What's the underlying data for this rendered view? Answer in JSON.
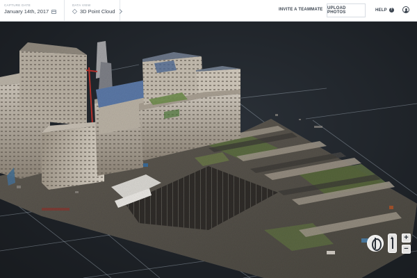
{
  "header": {
    "capture_date": {
      "label": "CAPTURE DATE",
      "value": "January 14th, 2017",
      "icon": "calendar-icon"
    },
    "data_view": {
      "label": "DATA VIEW",
      "value": "3D Point Cloud",
      "icon": "cube-icon"
    },
    "invite_label": "INVITE A TEAMMATE",
    "upload_label": "UPLOAD PHOTOS",
    "help_label": "HELP",
    "help_icon": "?"
  },
  "controls": {
    "zoom_in": "+",
    "zoom_out": "−"
  },
  "colors": {
    "viewport_bg": "#1d2126",
    "grid_line": "#9aa6b2",
    "accent_red": "#b3302a"
  }
}
